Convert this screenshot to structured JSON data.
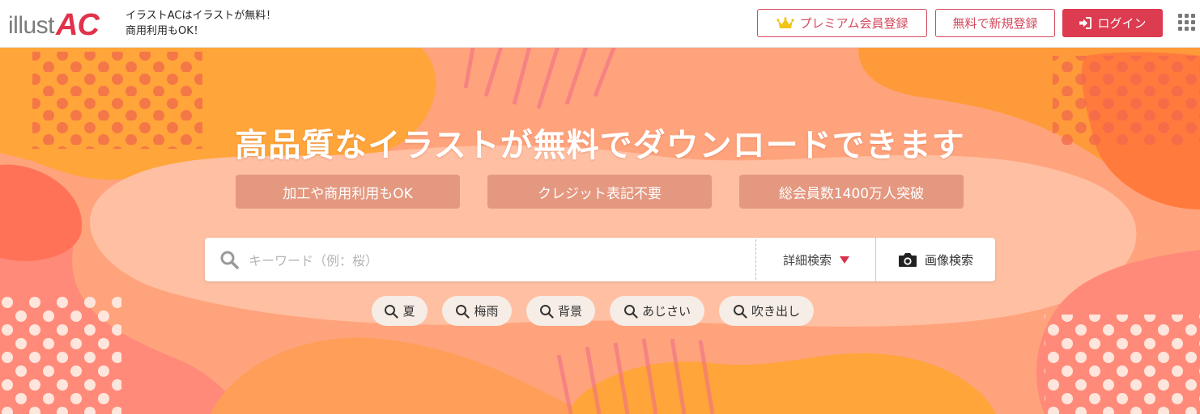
{
  "header": {
    "logo": {
      "illust": "illust",
      "ac": "AC"
    },
    "tagline": {
      "line1": "イラストACはイラストが無料！",
      "line2": "商用利用もOK！"
    },
    "premium_label": "プレミアム会員登録",
    "register_label": "無料で新規登録",
    "login_label": "ログイン"
  },
  "hero": {
    "headline": "高品質なイラストが無料でダウンロードできます",
    "features": [
      "加工や商用利用もOK",
      "クレジット表記不要",
      "総会員数1400万人突破"
    ]
  },
  "search": {
    "placeholder": "キーワード（例：桜）",
    "advanced_label": "詳細検索",
    "image_search_label": "画像検索"
  },
  "tags": [
    "夏",
    "梅雨",
    "背景",
    "あじさい",
    "吹き出し"
  ],
  "colors": {
    "brand": "#dc3b50",
    "hero_base": "#ffa77e",
    "caret": "#d6304a"
  },
  "icons": [
    "crown-icon",
    "login-icon",
    "grid-menu-icon",
    "search-icon",
    "camera-icon"
  ]
}
